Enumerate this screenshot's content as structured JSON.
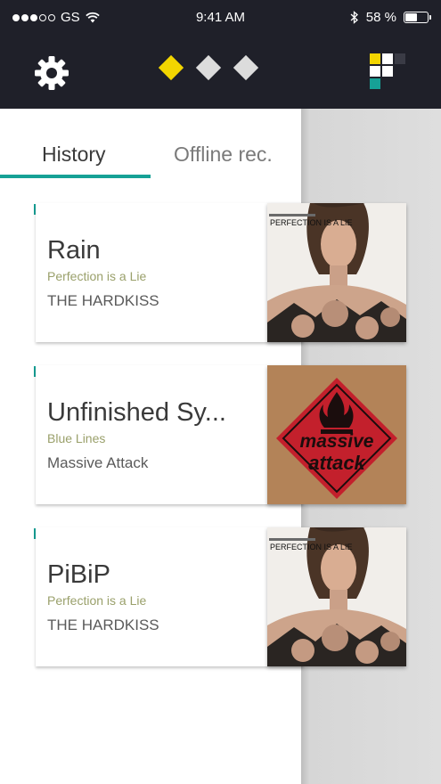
{
  "status_bar": {
    "carrier": "GS",
    "time": "9:41 AM",
    "battery": "58 %",
    "battery_level": 0.58
  },
  "header": {
    "page_indicator": [
      "active",
      "inactive",
      "inactive"
    ]
  },
  "tabs": [
    {
      "label": "History",
      "active": true
    },
    {
      "label": "Offline rec.",
      "active": false
    }
  ],
  "tracks": [
    {
      "title": "Rain",
      "album": "Perfection is a Lie",
      "artist": "THE HARDKISS",
      "cover": "perfection-is-a-lie-cover",
      "cover_text": "PERFECTION IS A LIE"
    },
    {
      "title": "Unfinished Sy...",
      "album": "Blue Lines",
      "artist": "Massive Attack",
      "cover": "massive-attack-cover",
      "cover_text_1": "massive",
      "cover_text_2": "attack"
    },
    {
      "title": "PiBiP",
      "album": "Perfection is a Lie",
      "artist": "THE HARDKISS",
      "cover": "perfection-is-a-lie-cover",
      "cover_text": "PERFECTION IS A LIE"
    }
  ],
  "colors": {
    "accent": "#16a196",
    "header_bg": "#1f2029",
    "indicator_active": "#f2d500"
  }
}
